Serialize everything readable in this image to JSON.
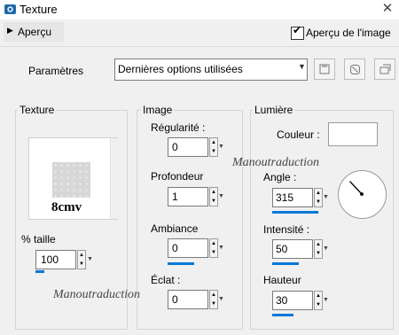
{
  "window": {
    "title": "Texture"
  },
  "toolbar": {
    "apercu_label": "Aperçu",
    "preview_check_label": "Aperçu de l'image",
    "preview_checked": true
  },
  "params": {
    "label": "Paramètres",
    "selected": "Dernières options utilisées"
  },
  "texture": {
    "label": "Texture",
    "preview_text": "8cmv",
    "taille_label": "% taille",
    "taille_value": "100"
  },
  "image": {
    "label": "Image",
    "fields": [
      {
        "label": "Régularité :",
        "value": "0"
      },
      {
        "label": "Profondeur",
        "value": "1"
      },
      {
        "label": "Ambiance",
        "value": "0"
      },
      {
        "label": "Éclat :",
        "value": "0"
      }
    ]
  },
  "light": {
    "label": "Lumière",
    "color_label": "Couleur :",
    "color": "#ffffff",
    "angle_label": "Angle :",
    "angle_value": "315",
    "intensity_label": "Intensité :",
    "intensity_value": "50",
    "height_label": "Hauteur",
    "height_value": "30"
  },
  "watermark": "Manoutraduction",
  "colors": {
    "accent": "#0078d7"
  }
}
